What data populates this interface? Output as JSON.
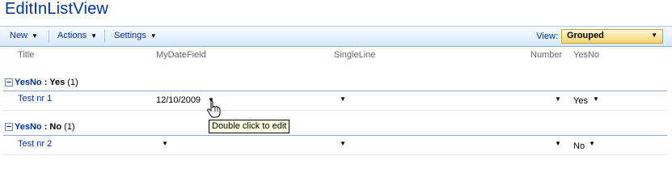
{
  "page": {
    "title": "EditInListView"
  },
  "toolbar": {
    "new_label": "New",
    "actions_label": "Actions",
    "settings_label": "Settings",
    "view_label": "View:",
    "view_value": "Grouped"
  },
  "columns": [
    "Title",
    "MyDateField",
    "SingleLine",
    "Number",
    "YesNo"
  ],
  "groups": [
    {
      "field": "YesNo",
      "sep": " : ",
      "value": "Yes",
      "count": " (1)",
      "rows": [
        {
          "title": "Test nr 1",
          "date": "12/10/2009",
          "yesno": "Yes"
        }
      ]
    },
    {
      "field": "YesNo",
      "sep": " : ",
      "value": "No",
      "count": " (1)",
      "rows": [
        {
          "title": "Test nr 2",
          "date": "",
          "yesno": "No"
        }
      ]
    }
  ],
  "tooltip": {
    "text": "Double click to edit"
  },
  "icons": {
    "caret": "dropdown-caret-icon",
    "collapse": "collapse-minus-icon",
    "cursor": "hand-pointer-icon"
  },
  "colors": {
    "link": "#003399",
    "toolbar_border": "#8db2e3",
    "view_select": "#f6d56f",
    "tooltip_bg": "#ffffe1"
  }
}
